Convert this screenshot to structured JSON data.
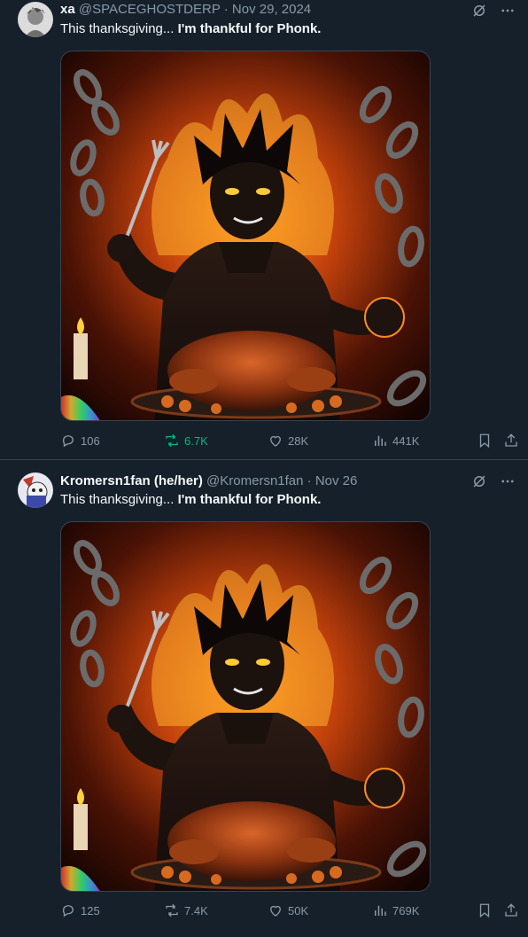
{
  "tweets": [
    {
      "name": "xa",
      "handle": "@SPACEGHOSTDERP",
      "separator": "·",
      "date": "Nov 29, 2024",
      "text_plain": "This thanksgiving... ",
      "text_bold": "I'm thankful for Phonk.",
      "stats": {
        "replies": "106",
        "reposts": "6.7K",
        "likes": "28K",
        "views": "441K"
      },
      "repost_active": true,
      "accent": "#00ba7c"
    },
    {
      "name": "Kromersn1fan (he/her)",
      "handle": "@Kromersn1fan",
      "separator": "·",
      "date": "Nov 26",
      "text_plain": "This thanksgiving... ",
      "text_bold": "I'm thankful for Phonk.",
      "stats": {
        "replies": "125",
        "reposts": "7.4K",
        "likes": "50K",
        "views": "769K"
      },
      "repost_active": false
    }
  ],
  "icons": {
    "reply": "reply-icon",
    "repost": "repost-icon",
    "like": "heart-icon",
    "views": "views-icon",
    "bookmark": "bookmark-icon",
    "share": "share-icon",
    "grok": "grok-icon",
    "more": "more-icon"
  },
  "colors": {
    "background": "#15202b",
    "muted": "#8b98a5",
    "text": "#f7f9f9",
    "divider": "#38444d"
  }
}
